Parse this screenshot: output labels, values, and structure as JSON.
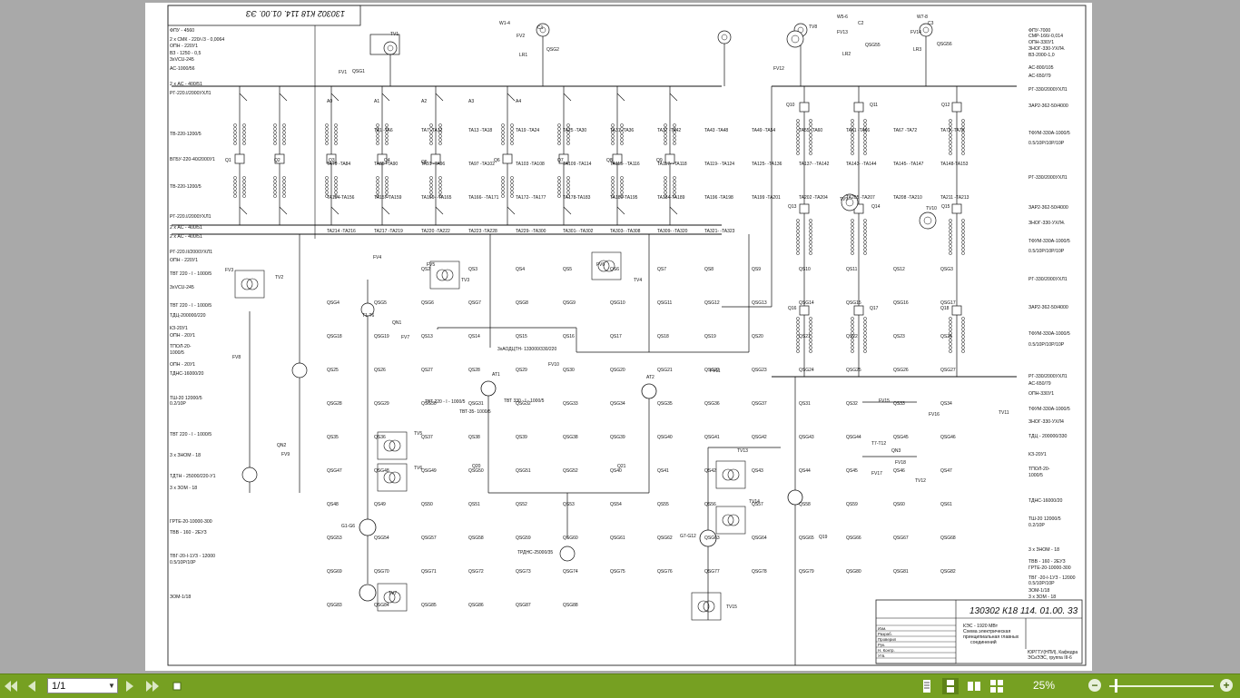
{
  "toolbar": {
    "page_selector_value": "1/1",
    "zoom_level": "25%",
    "buttons": [
      "first-page",
      "previous-page",
      "next-page",
      "last-page",
      "single-page-view",
      "continuous-view",
      "two-page-view",
      "two-page-continuous-view",
      "zoom-out",
      "zoom-in"
    ]
  },
  "drawing": {
    "stamp_rotated": "130302 К18 114. 01.00. ЭЗ",
    "stamp_main": "130302 К18 114. 01.00. 33",
    "title_block": {
      "line1": "КЭС - 1920 МВт",
      "line2": "Схема электрическая",
      "line3": "принципиальная главных",
      "line4": "соединений",
      "org1": "ЮРГТУ(НПИ), Кафедра",
      "org2": "ЭСиЭЭС, группа III-6",
      "roles": [
        "Изм.",
        "Разраб.",
        "Проверил",
        "Рук.",
        "Н. Контр.",
        "Утв."
      ]
    },
    "left_notes": [
      "ФПУ - 4560",
      "2 х СМК - 220/√3 - 0,0064",
      "ОПН - 220У1",
      "ВЗ - 1250 - 0,5",
      "3хVCU-245",
      "АС-1000/56",
      "2 х АС - 400/51",
      "РГ-220.I/2000УХЛ1",
      "ТВ-220-1200/5",
      "ВГБУ-220-40/2000У1",
      "ТВ-220-1200/5",
      "РГ-220.I/2000УХЛ1",
      "2 х АС - 400/51",
      "2 х АС - 400/51",
      "РГ-220.II/2000УХЛ1",
      "ОПН - 220У1",
      "ТВТ 220 - I - 1000/5",
      "3хVCU-245",
      "ТВТ 220 - I - 1000/5",
      "ТДЦ-200000/220",
      "КЗ-20У1",
      "ОПН - 20У1",
      "ТПОЛ-20-",
      "1000/5",
      "ОПН - 20У1",
      "ТДНС-16000/20",
      "ТШ-20 12000/5",
      "0.2/10Р",
      "ТВТ 220 - I - 1000/5",
      "3 х ЗНОМ - 18",
      "ТДТН - 25000/220-У1",
      "3 х ЗОМ - 18",
      "ГРТЕ-20-10000-300",
      "ТВВ - 160 - 2ЕУЗ",
      "ТВГ-20-I-1УЗ - 12000",
      "0.5/10Р/10Р",
      "ЗОМ-1/18"
    ],
    "right_notes": [
      "ФПУ-7000",
      "СМР-166/-0,014",
      "ОПН-330У1",
      "ЗНОГ-330-УХЛ4.",
      "ВЗ-2000-1,0",
      "АС-800/105",
      "АС-650/79",
      "РГ-330/2000УХЛ1",
      "ЗАР2-362-50/4000",
      "ТФУМ-330А-1000/5",
      "0.5/10Р/10Р/10Р",
      "РГ-330/2000УХЛ1",
      "ЗАР2-362-50/4000",
      "ЗНОГ-330-УХЛ4.",
      "ТФУМ-330А-1000/5",
      "0.5/10Р/10Р/10Р",
      "РГ-330/2000УХЛ1",
      "ЗАР2-362-50/4000",
      "ТФУМ-330А-1000/5",
      "0.5/10Р/10Р/10Р",
      "РГ-330/2000УХЛ1",
      "АС-650/79",
      "ОПН-330У1",
      "ТФУМ-330А-1000/5",
      "ЗНОГ-330-УХЛ4",
      "ТДЦ - 200000/330",
      "КЗ-20У1",
      "ТПОЛ-20-",
      "1000/5",
      "ТДНС-16000/20",
      "ТШ-20 12000/5",
      "0.2/10Р",
      "3 х ЗНОМ - 18",
      "ТВВ - 160 - 2ЕУЗ",
      "ГРТЕ-20-10000-300",
      "ТВГ -20-I-1УЗ - 12000",
      "0.5/10Р/10Р",
      "ЗОМ-1/18",
      "3 х ЗОМ - 18"
    ],
    "labels": [
      "А0",
      "А1",
      "А2",
      "А3",
      "А4",
      "TV1",
      "TV2",
      "TV3",
      "TV4",
      "TV5",
      "TV6",
      "TV7",
      "TV8",
      "TV9",
      "TV10",
      "TV11",
      "TV12",
      "TV13",
      "TV14",
      "TV15",
      "W1-4",
      "W5-6",
      "W7-8",
      "C1",
      "C2",
      "C3",
      "LR1",
      "LR2",
      "LR3",
      "FV1",
      "FV2",
      "FV3",
      "FV4",
      "FV5",
      "FV6",
      "FV7",
      "FV8",
      "FV9",
      "FV10",
      "FV11",
      "FV12",
      "FV13",
      "FV14",
      "FV15",
      "FV16",
      "FV17",
      "FV18",
      "QSG1",
      "QSG2",
      "QSG55",
      "QSG56",
      "Q1",
      "Q2",
      "Q3",
      "Q4",
      "Q5",
      "Q6",
      "Q7",
      "Q8",
      "Q9",
      "Q10",
      "Q11",
      "Q12",
      "Q13",
      "Q14",
      "Q15",
      "Q16",
      "Q17",
      "Q18",
      "Q19",
      "Q20",
      "Q21",
      "QS2",
      "QS3",
      "QS4",
      "QS5",
      "QS6",
      "QS7",
      "QS8",
      "QS9",
      "QS10",
      "QS11",
      "QS12",
      "QSG3",
      "QSG4",
      "QSG5",
      "QSG6",
      "QSG7",
      "QSG8",
      "QSG9",
      "QSG10",
      "QSG11",
      "QSG12",
      "QSG13",
      "QSG14",
      "QSG15",
      "QSG16",
      "QSG17",
      "QSG18",
      "QSG19",
      "QS13",
      "QS14",
      "QS15",
      "QS16",
      "QS17",
      "QS18",
      "QS19",
      "QS20",
      "QS21",
      "QS22",
      "QS23",
      "QS24",
      "QS25",
      "QS26",
      "QS27",
      "QS28",
      "QS29",
      "QS30",
      "QSG20",
      "QSG21",
      "QSG22",
      "QSG23",
      "QSG24",
      "QSG25",
      "QSG26",
      "QSG27",
      "QSG28",
      "QSG29",
      "QSG30",
      "QSG31",
      "QSG32",
      "QSG33",
      "QSG34",
      "QSG35",
      "QSG36",
      "QSG37",
      "QS31",
      "QS32",
      "QS33",
      "QS34",
      "QS35",
      "QS36",
      "QS37",
      "QS38",
      "QS39",
      "QSG38",
      "QSG39",
      "QSG40",
      "QSG41",
      "QSG42",
      "QSG43",
      "QSG44",
      "QSG45",
      "QSG46",
      "QSG47",
      "QSG48",
      "QSG49",
      "QSG50",
      "QSG51",
      "QSG52",
      "QS40",
      "QS41",
      "QS42",
      "QS43",
      "QS44",
      "QS45",
      "QS46",
      "QS47",
      "QS48",
      "QS49",
      "QS50",
      "QS51",
      "QS52",
      "QS53",
      "QS54",
      "QS55",
      "QS56",
      "QS57",
      "QS58",
      "QS59",
      "QS60",
      "QS61",
      "QSG53",
      "QSG54",
      "QSG57",
      "QSG58",
      "QSG59",
      "QSG60",
      "QSG61",
      "QSG62",
      "QSG63",
      "QSG64",
      "QSG65",
      "QSG66",
      "QSG67",
      "QSG68",
      "QSG69",
      "QSG70",
      "QSG71",
      "QSG72",
      "QSG73",
      "QSG74",
      "QSG75",
      "QSG76",
      "QSG77",
      "QSG78",
      "QSG79",
      "QSG80",
      "QSG81",
      "QSG82",
      "QSG83",
      "QSG84",
      "QSG85",
      "QSG86",
      "QSG87",
      "QSG88",
      "QN1",
      "QN2",
      "QN3",
      "AT1",
      "AT2",
      "G1-G6",
      "G7-G12",
      "T1-T6",
      "T7-T12",
      "TA1 -TA6",
      "TA7 -TA12",
      "TA13 -TA18",
      "TA19 -TA24",
      "TA25 -TA30",
      "TA31 -TA36",
      "TA37 -TA42",
      "TA43 -TA48",
      "TA49 -TA54",
      "TA55 -TA60",
      "TA61 -TA66",
      "TA67 -TA72",
      "TA73 -TA78",
      "TA79 -TA84",
      "TA85 -TA90",
      "TA91 -TA96",
      "TA97 -TA102",
      "TA103 -TA108",
      "TA109 -TA114",
      "TA115- -TA116",
      "TA117- -TA118",
      "TA119- -TA124",
      "TA125- -TA136",
      "TA137- -TA142",
      "TA143- -TA144",
      "TA145- -TA147",
      "TA148-TA153",
      "TA154-TA156",
      "TA157-TA159",
      "TA160- -TA165",
      "TA166- -TA171",
      "TA172- -TA177",
      "TA178-TA183",
      "TA180-TA195",
      "TA184-TA189",
      "TA196 -TA198",
      "TA199 -TA201",
      "TA202 -TA204",
      "TA205 -TA207",
      "TA208 -TA210",
      "TA211 -TA213",
      "TA214 -TA216",
      "TA217 -TA219",
      "TA220 -TA222",
      "TA223 -TA228",
      "TA229- -TA300",
      "TA301- -TA302",
      "TA303- -TA308",
      "TA309- -TA320",
      "TA321- -TA323",
      "3хАОДЦТН- 133000/330/220",
      "ТВТ 220 - I - 1000/5",
      "ТВТ 330 - I - 1000/5",
      "ТВТ-35- 1000/5",
      "ТРДНС-25000/35"
    ]
  }
}
